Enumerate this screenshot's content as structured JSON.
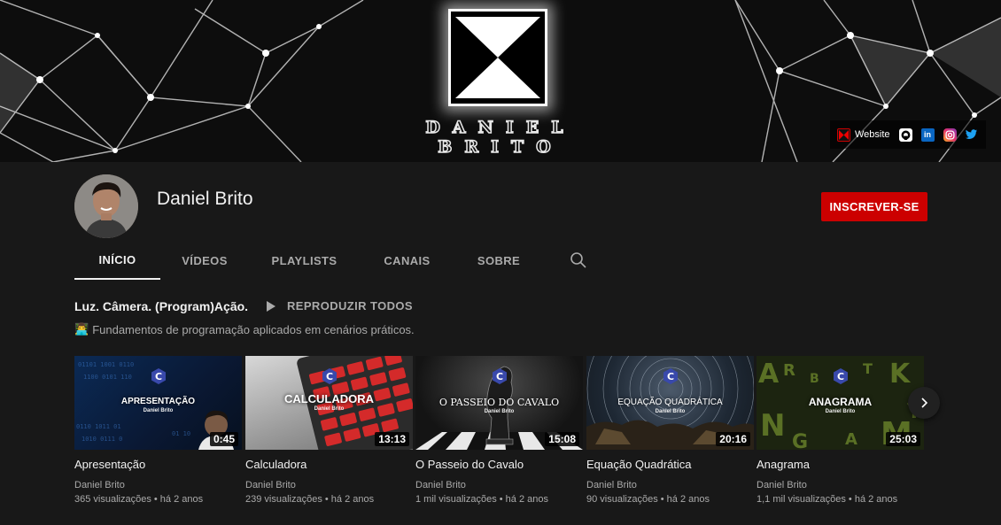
{
  "banner": {
    "logo_name_line1": "DANIEL",
    "logo_name_line2": "BRITO",
    "links": [
      {
        "label": "Website",
        "icon": "daniel-brito-logo-icon"
      },
      {
        "label": "",
        "icon": "github-icon"
      },
      {
        "label": "",
        "icon": "linkedin-icon"
      },
      {
        "label": "",
        "icon": "instagram-icon"
      },
      {
        "label": "",
        "icon": "twitter-icon"
      }
    ]
  },
  "channel": {
    "name": "Daniel Brito",
    "subscribe_label": "INSCREVER-SE"
  },
  "tabs": [
    {
      "label": "INÍCIO",
      "active": true
    },
    {
      "label": "VÍDEOS",
      "active": false
    },
    {
      "label": "PLAYLISTS",
      "active": false
    },
    {
      "label": "CANAIS",
      "active": false
    },
    {
      "label": "SOBRE",
      "active": false
    }
  ],
  "section": {
    "title": "Luz. Câmera. (Program)Ação.",
    "play_all_label": "REPRODUZIR TODOS",
    "description_emoji": "👨‍💻",
    "description": "Fundamentos de programação aplicados em cenários práticos."
  },
  "videos": [
    {
      "thumb_title": "APRESENTAÇÃO",
      "thumb_sub": "Daniel Brito",
      "duration": "0:45",
      "title": "Apresentação",
      "channel": "Daniel Brito",
      "meta": "365 visualizações • há 2 anos"
    },
    {
      "thumb_title": "CALCULADORA",
      "thumb_sub": "Daniel Brito",
      "duration": "13:13",
      "title": "Calculadora",
      "channel": "Daniel Brito",
      "meta": "239 visualizações • há 2 anos"
    },
    {
      "thumb_title": "O PASSEIO DO CAVALO",
      "thumb_sub": "Daniel Brito",
      "duration": "15:08",
      "title": "O Passeio do Cavalo",
      "channel": "Daniel Brito",
      "meta": "1 mil visualizações • há 2 anos"
    },
    {
      "thumb_title": "EQUAÇÃO QUADRÁTICA",
      "thumb_sub": "Daniel Brito",
      "duration": "20:16",
      "title": "Equação Quadrática",
      "channel": "Daniel Brito",
      "meta": "90 visualizações • há 2 anos"
    },
    {
      "thumb_title": "ANAGRAMA",
      "thumb_sub": "Daniel Brito",
      "duration": "25:03",
      "title": "Anagrama",
      "channel": "Daniel Brito",
      "meta": "1,1 mil visualizações • há 2 anos"
    }
  ],
  "colors": {
    "background": "#181818",
    "subscribe": "#cc0000",
    "text_primary": "#f1f1f1",
    "text_secondary": "#aaaaaa"
  }
}
